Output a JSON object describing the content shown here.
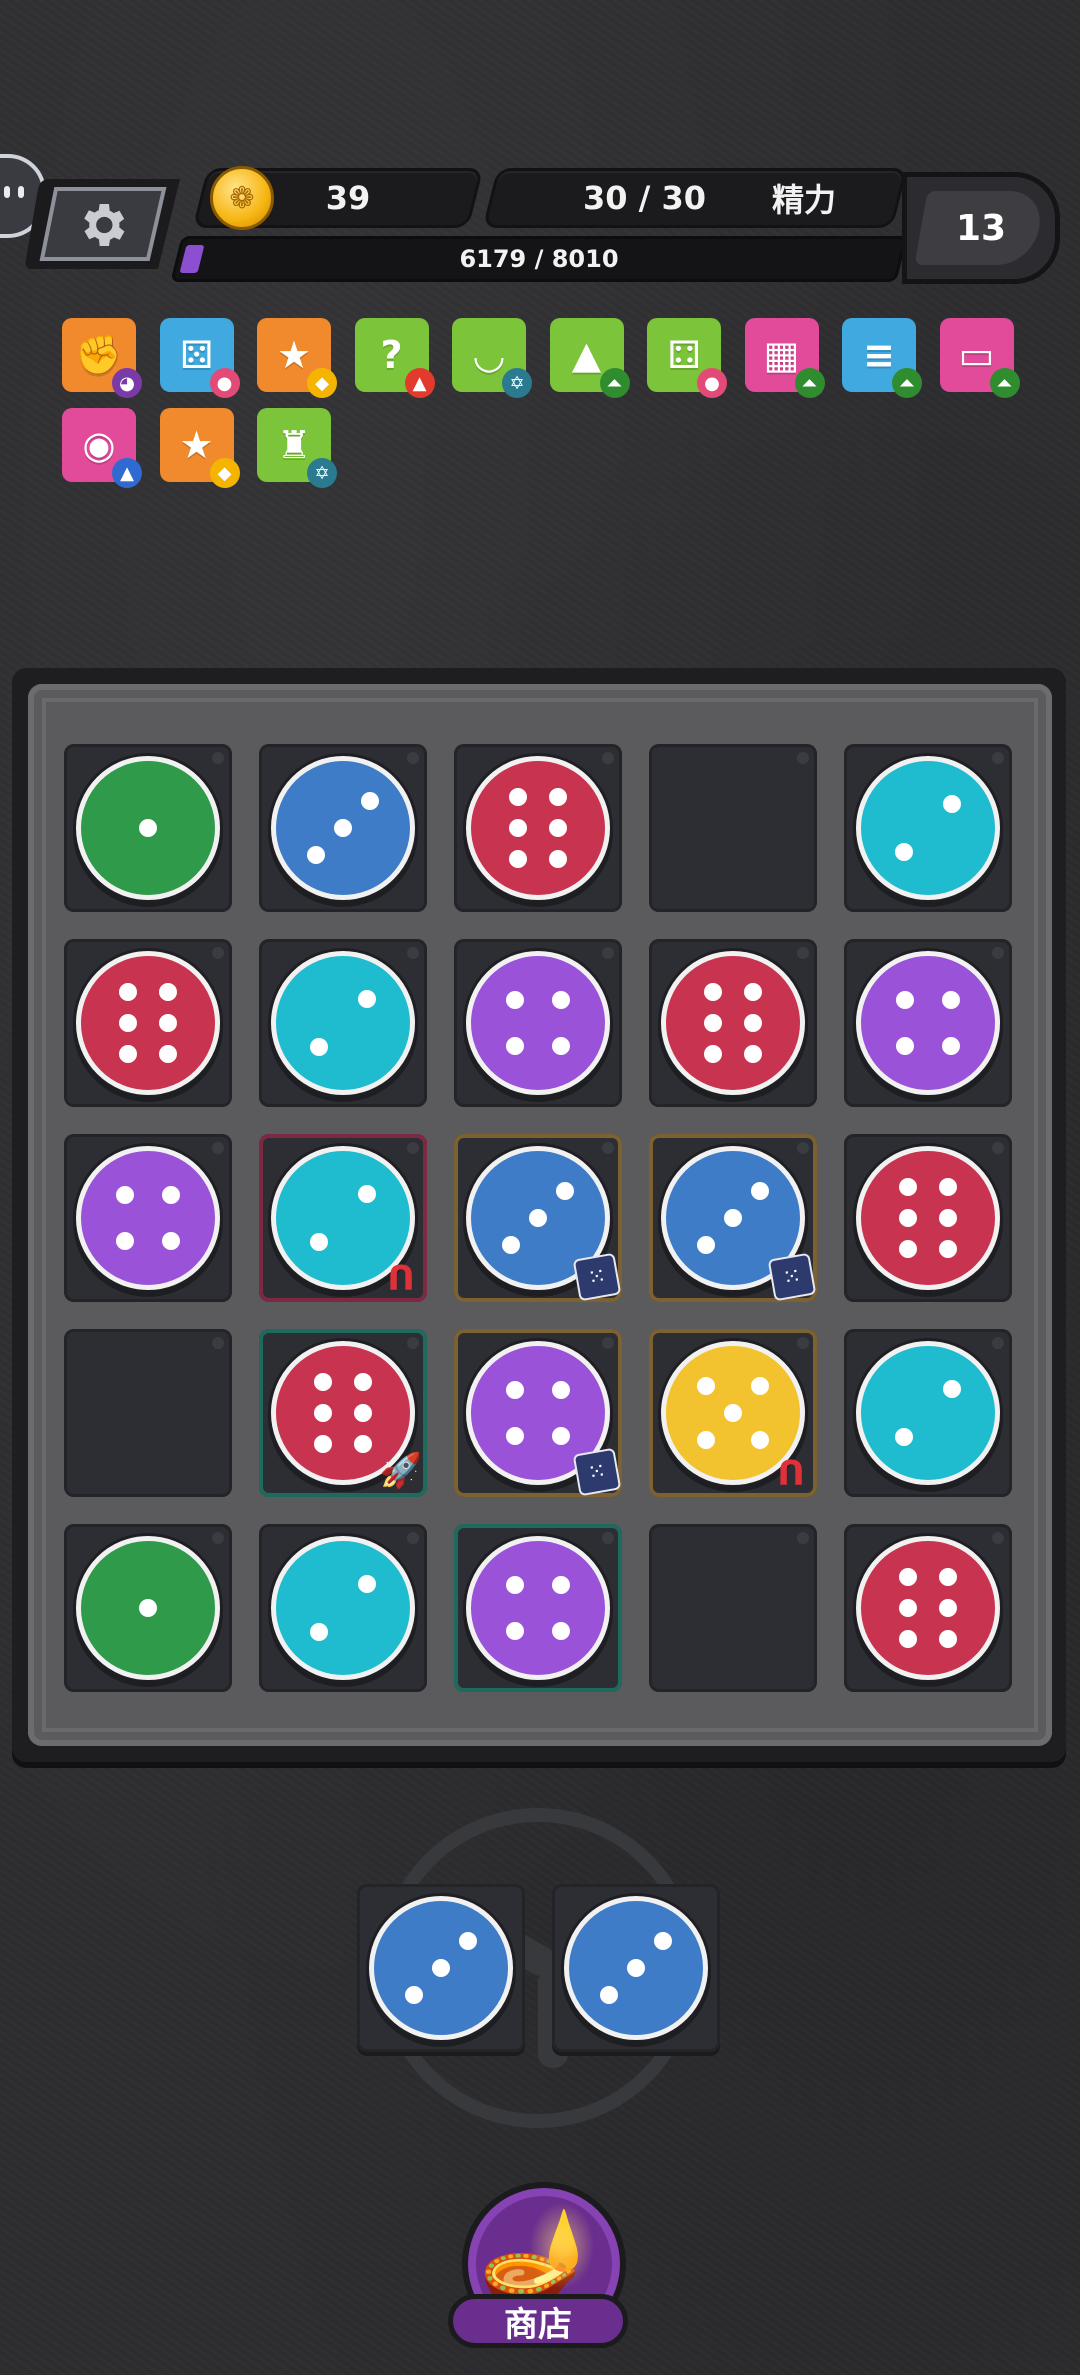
{
  "hud": {
    "coins": "39",
    "energy": "30 / 30",
    "energy_label": "精力",
    "xp": "6179 / 8010",
    "xp_fraction": 0.771,
    "level": "13"
  },
  "buffs": [
    {
      "name": "punch-buff-icon",
      "color": "#f08a2c",
      "glyph": "✊",
      "badge": "cat",
      "badgeColor": "#7a3aa8",
      "badgeGlyph": "◕"
    },
    {
      "name": "dice-buff-icon",
      "color": "#3fa9e0",
      "glyph": "⚄",
      "badge": "paw",
      "badgeColor": "#e24b77",
      "badgeGlyph": "●"
    },
    {
      "name": "star-2-buff-icon",
      "color": "#f08a2c",
      "glyph": "★",
      "badge": "coin",
      "badgeColor": "#f4b400",
      "badgeGlyph": "◆"
    },
    {
      "name": "mystery-buff-icon",
      "color": "#7cc43a",
      "glyph": "?",
      "badge": "up",
      "badgeColor": "#e23b2e",
      "badgeGlyph": "▲"
    },
    {
      "name": "bowl-buff-icon",
      "color": "#7cc43a",
      "glyph": "◡",
      "badge": "card",
      "badgeColor": "#2a7a90",
      "badgeGlyph": "✡"
    },
    {
      "name": "pyramid-buff-icon",
      "color": "#7cc43a",
      "glyph": "▲",
      "badge": "double-up",
      "badgeColor": "#2f8c2f",
      "badgeGlyph": "⏶"
    },
    {
      "name": "dice-card-buff-icon",
      "color": "#7cc43a",
      "glyph": "⚃",
      "badge": "paw",
      "badgeColor": "#e24b77",
      "badgeGlyph": "●"
    },
    {
      "name": "blocks-buff-icon",
      "color": "#e24b9a",
      "glyph": "▦",
      "badge": "double-up",
      "badgeColor": "#2f8c2f",
      "badgeGlyph": "⏶"
    },
    {
      "name": "database-buff-icon",
      "color": "#3fa9e0",
      "glyph": "≡",
      "badge": "double-up",
      "badgeColor": "#2f8c2f",
      "badgeGlyph": "⏶"
    },
    {
      "name": "card-buff-icon",
      "color": "#e24b9a",
      "glyph": "▭",
      "badge": "double-up",
      "badgeColor": "#2f8c2f",
      "badgeGlyph": "⏶"
    },
    {
      "name": "ball-buff-icon",
      "color": "#e24b9a",
      "glyph": "◉",
      "badge": "up",
      "badgeColor": "#2f6ad0",
      "badgeGlyph": "▲"
    },
    {
      "name": "star-3-buff-icon",
      "color": "#f08a2c",
      "glyph": "★",
      "badge": "coin",
      "badgeColor": "#f4b400",
      "badgeGlyph": "◆"
    },
    {
      "name": "piggy-bank-buff-icon",
      "color": "#7cc43a",
      "glyph": "♜",
      "badge": "card",
      "badgeColor": "#2a7a90",
      "badgeGlyph": "✡"
    }
  ],
  "colors": {
    "green": "#2e9a4a",
    "blue": "#3f7cc8",
    "red": "#c8334f",
    "cyan": "#1fbcd0",
    "purple": "#9a52d8",
    "yellow": "#f2c32e"
  },
  "board": [
    [
      {
        "c": "green",
        "v": 1
      },
      {
        "c": "blue",
        "v": 3
      },
      {
        "c": "red",
        "v": 6
      },
      null,
      {
        "c": "cyan",
        "v": 2
      }
    ],
    [
      {
        "c": "red",
        "v": 6
      },
      {
        "c": "cyan",
        "v": 2
      },
      {
        "c": "purple",
        "v": 4
      },
      {
        "c": "red",
        "v": 6
      },
      {
        "c": "purple",
        "v": 4
      }
    ],
    [
      {
        "c": "purple",
        "v": 4
      },
      {
        "c": "cyan",
        "v": 2,
        "hl": "red",
        "tag": "magnet"
      },
      {
        "c": "blue",
        "v": 3,
        "hl": "gold",
        "tag": "dice"
      },
      {
        "c": "blue",
        "v": 3,
        "hl": "gold",
        "tag": "dice"
      },
      {
        "c": "red",
        "v": 6
      }
    ],
    [
      null,
      {
        "c": "red",
        "v": 6,
        "hl": "teal",
        "tag": "rocket"
      },
      {
        "c": "purple",
        "v": 4,
        "hl": "gold",
        "tag": "dice"
      },
      {
        "c": "yellow",
        "v": 5,
        "hl": "gold",
        "tag": "magnet"
      },
      {
        "c": "cyan",
        "v": 2
      }
    ],
    [
      {
        "c": "green",
        "v": 1
      },
      {
        "c": "cyan",
        "v": 2
      },
      {
        "c": "purple",
        "v": 4,
        "hl": "teal"
      },
      null,
      {
        "c": "red",
        "v": 6
      }
    ]
  ],
  "tray": [
    {
      "c": "blue",
      "v": 3
    },
    {
      "c": "blue",
      "v": 3
    }
  ],
  "shop": {
    "label": "商店"
  }
}
